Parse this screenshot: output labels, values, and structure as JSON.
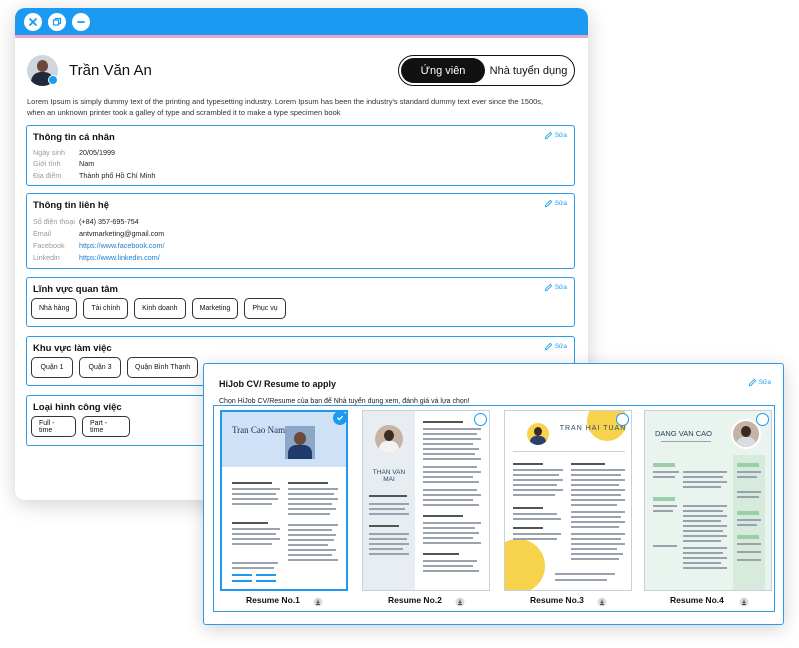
{
  "window": {
    "controls": [
      "close-icon",
      "restore-icon",
      "minimize-icon"
    ],
    "accent_color": "#1a9bf1"
  },
  "profile": {
    "name": "Trần Văn An",
    "bio": "Lorem Ipsum is simply dummy text of the printing and typesetting industry. Lorem Ipsum has been the industry's standard dummy text ever since the 1500s, when an unknown printer took a galley of type and scrambled it to make a type specimen book"
  },
  "role_toggle": {
    "candidate": "Ứng viên",
    "employer": "Nhà tuyển dụng",
    "selected": "Ứng viên"
  },
  "edit_label": "Sửa",
  "personal": {
    "title": "Thông tin cá nhân",
    "birth_label": "Ngày sinh",
    "birth_value": "20/05/1999",
    "gender_label": "Giới tính",
    "gender_value": "Nam",
    "place_label": "Địa điểm",
    "place_value": "Thành phố Hồ Chí Minh"
  },
  "contact": {
    "title": "Thông tin liên hệ",
    "phone_label": "Số điện thoại",
    "phone_value": "(+84) 357-695-754",
    "email_label": "Email",
    "email_value": "antvmarketing@gmail.com",
    "facebook_label": "Facebook",
    "facebook_value": "https://www.facebook.com/",
    "linkedin_label": "Linkedin",
    "linkedin_value": "https://www.linkedin.com/"
  },
  "interests": {
    "title": "Lĩnh vực quan tâm",
    "chips": [
      "Nhà hàng",
      "Tài chính",
      "Kinh doanh",
      "Marketing",
      "Phục vụ"
    ]
  },
  "work_area": {
    "title": "Khu vực làm việc",
    "chips": [
      "Quận 1",
      "Quận 3",
      "Quận Bình Thạnh"
    ]
  },
  "job_type": {
    "title": "Loại hình công việc",
    "chips": [
      "Full - time",
      "Part - time"
    ]
  },
  "cv_popup": {
    "title": "HiJob CV/ Resume to apply",
    "subtitle": "Chọn HiJob CV/Resume của bạn  để Nhà tuyển dụng xem, đánh giá và lựa chọn!",
    "resumes": [
      {
        "label": "Resume No.1",
        "selected": true,
        "name": "Tran Cao Nam"
      },
      {
        "label": "Resume No.2",
        "selected": false,
        "name": "THAN VAN MAI"
      },
      {
        "label": "Resume No.3",
        "selected": false,
        "name": "TRAN HAI TUAN"
      },
      {
        "label": "Resume No.4",
        "selected": false,
        "name": "DANG VAN CAO"
      }
    ]
  }
}
